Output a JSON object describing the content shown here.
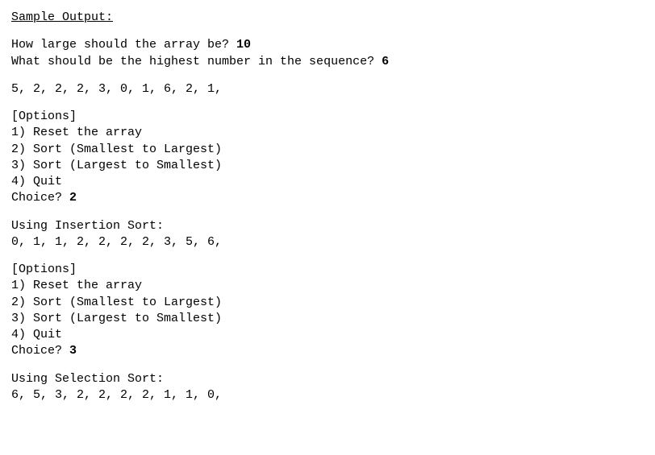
{
  "heading": "Sample Output:",
  "prompts": {
    "arraySize": {
      "label": "How large should the array be? ",
      "value": "10"
    },
    "highest": {
      "label": "What should be the highest number in the sequence? ",
      "value": "6"
    }
  },
  "initialArray": "5, 2, 2, 2, 3, 0, 1, 6, 2, 1,",
  "menu1": {
    "title": "[Options]",
    "items": [
      "1) Reset the array",
      "2) Sort (Smallest to Largest)",
      "3) Sort (Largest to Smallest)",
      "4) Quit"
    ],
    "choiceLabel": "Choice? ",
    "choiceValue": "2"
  },
  "result1": {
    "title": "Using Insertion Sort:",
    "array": "0, 1, 1, 2, 2, 2, 2, 3, 5, 6,"
  },
  "menu2": {
    "title": "[Options]",
    "items": [
      "1) Reset the array",
      "2) Sort (Smallest to Largest)",
      "3) Sort (Largest to Smallest)",
      "4) Quit"
    ],
    "choiceLabel": "Choice? ",
    "choiceValue": "3"
  },
  "result2": {
    "title": "Using Selection Sort:",
    "array": "6, 5, 3, 2, 2, 2, 2, 1, 1, 0,"
  }
}
